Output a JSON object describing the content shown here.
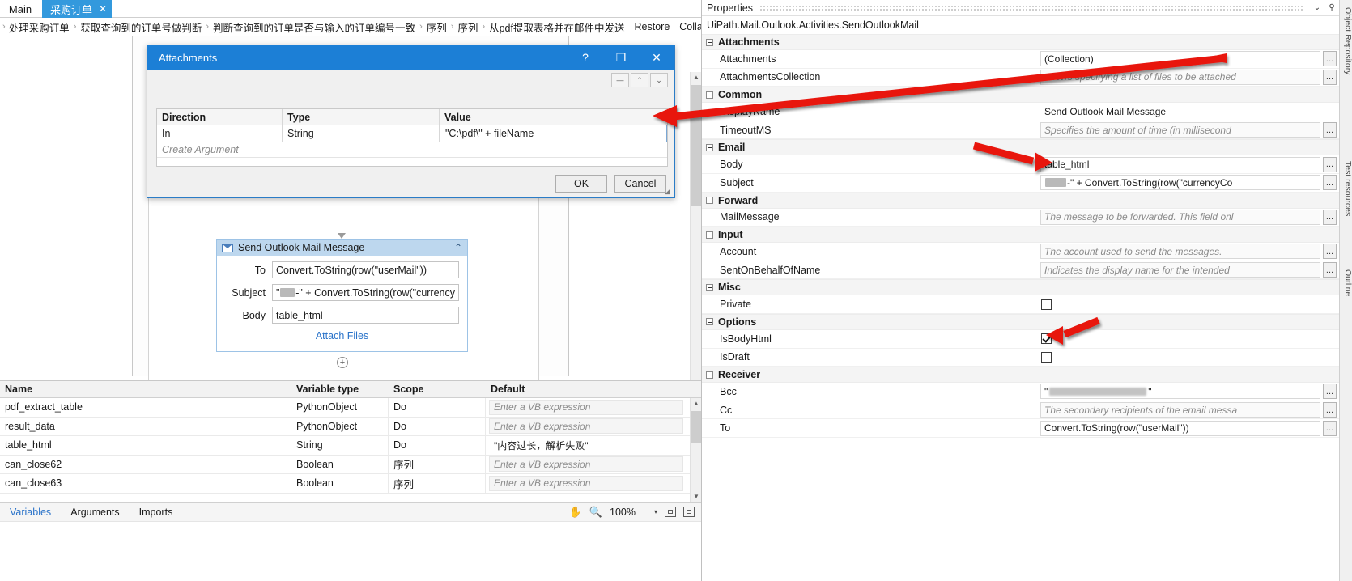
{
  "tabs": {
    "main_label": "Main",
    "active_label": "采购订单",
    "close_glyph": "✕"
  },
  "breadcrumb": {
    "lead": "›",
    "separator": "›",
    "items": [
      "处理采购订单",
      "获取查询到的订单号做判断",
      "判断查询到的订单是否与输入的订单编号一致",
      "序列",
      "序列",
      "从pdf提取表格并在邮件中发送"
    ],
    "restore_label": "Restore",
    "collapse_all_label": "Collapse All"
  },
  "dialog": {
    "title": "Attachments",
    "help_glyph": "?",
    "maximize_glyph": "❐",
    "close_glyph": "✕",
    "toolbar": {
      "remove_glyph": "—",
      "up_glyph": "⌃",
      "down_glyph": "⌄"
    },
    "grid": {
      "headers": [
        "Direction",
        "Type",
        "Value"
      ],
      "rows": [
        {
          "direction": "In",
          "type": "String",
          "value": "\"C:\\pdf\\\" + fileName"
        }
      ],
      "create_argument_placeholder": "Create Argument"
    },
    "ok_label": "OK",
    "cancel_label": "Cancel"
  },
  "activity": {
    "icon": "mail-icon",
    "title": "Send Outlook Mail Message",
    "collapse_glyph": "⌃",
    "fields": [
      {
        "label": "To",
        "value": "Convert.ToString(row(\"userMail\"))",
        "redacted": false
      },
      {
        "label": "Subject",
        "value_prefix": "\"",
        "value_suffix": "-\" + Convert.ToString(row(\"currency",
        "redacted": true
      },
      {
        "label": "Body",
        "value": "table_html",
        "redacted": false
      }
    ],
    "attach_files_label": "Attach Files",
    "add_node_glyph": "+"
  },
  "variables": {
    "headers": [
      "Name",
      "Variable type",
      "Scope",
      "Default"
    ],
    "placeholder": "Enter a VB expression",
    "rows": [
      {
        "name": "pdf_extract_table",
        "type": "PythonObject",
        "scope": "Do",
        "default": "",
        "default_is_placeholder": true
      },
      {
        "name": "result_data",
        "type": "PythonObject",
        "scope": "Do",
        "default": "",
        "default_is_placeholder": true
      },
      {
        "name": "table_html",
        "type": "String",
        "scope": "Do",
        "default": "\"内容过长，解析失败\"",
        "default_is_placeholder": false
      },
      {
        "name": "can_close62",
        "type": "Boolean",
        "scope": "序列",
        "default": "",
        "default_is_placeholder": true
      },
      {
        "name": "can_close63",
        "type": "Boolean",
        "scope": "序列",
        "default": "",
        "default_is_placeholder": true
      }
    ]
  },
  "bottom_bar": {
    "tabs": [
      "Variables",
      "Arguments",
      "Imports"
    ],
    "active_tab": "Variables",
    "pan_icon": "hand-icon",
    "zoom_icon": "magnifier-icon",
    "zoom_value": "100%",
    "zoom_caret": "▾",
    "fit_icon": "fit-to-screen-icon",
    "overview_icon": "overview-icon"
  },
  "properties": {
    "panel_title": "Properties",
    "collapse_glyph": "⌄",
    "pin_glyph": "📌",
    "subtitle": "UiPath.Mail.Outlook.Activities.SendOutlookMail",
    "ellipsis_label": "...",
    "groups": [
      {
        "name": "Attachments",
        "rows": [
          {
            "label": "Attachments",
            "value": "(Collection)",
            "placeholder": false,
            "ellipsis": true,
            "control": "text"
          },
          {
            "label": "AttachmentsCollection",
            "value": "Allows specifying a list of files to be attached",
            "placeholder": true,
            "ellipsis": true,
            "control": "text"
          }
        ]
      },
      {
        "name": "Common",
        "rows": [
          {
            "label": "DisplayName",
            "value": "Send Outlook Mail Message",
            "placeholder": false,
            "ellipsis": false,
            "control": "plain"
          },
          {
            "label": "TimeoutMS",
            "value": "Specifies the amount of time (in millisecond",
            "placeholder": true,
            "ellipsis": true,
            "control": "text"
          }
        ]
      },
      {
        "name": "Email",
        "rows": [
          {
            "label": "Body",
            "value": "table_html",
            "placeholder": false,
            "ellipsis": true,
            "control": "text"
          },
          {
            "label": "Subject",
            "value": "-\" + Convert.ToString(row(\"currencyCo",
            "placeholder": false,
            "ellipsis": true,
            "control": "redacted-text"
          }
        ]
      },
      {
        "name": "Forward",
        "rows": [
          {
            "label": "MailMessage",
            "value": "The message to be forwarded. This field onl",
            "placeholder": true,
            "ellipsis": true,
            "control": "text"
          }
        ]
      },
      {
        "name": "Input",
        "rows": [
          {
            "label": "Account",
            "value": "The account used to send the messages.",
            "placeholder": true,
            "ellipsis": true,
            "control": "text"
          },
          {
            "label": "SentOnBehalfOfName",
            "value": "Indicates the display name for the intended",
            "placeholder": true,
            "ellipsis": true,
            "control": "text"
          }
        ]
      },
      {
        "name": "Misc",
        "rows": [
          {
            "label": "Private",
            "value": "",
            "placeholder": false,
            "ellipsis": false,
            "control": "checkbox",
            "checked": false
          }
        ]
      },
      {
        "name": "Options",
        "rows": [
          {
            "label": "IsBodyHtml",
            "value": "",
            "placeholder": false,
            "ellipsis": false,
            "control": "checkbox",
            "checked": true
          },
          {
            "label": "IsDraft",
            "value": "",
            "placeholder": false,
            "ellipsis": false,
            "control": "checkbox",
            "checked": false
          }
        ]
      },
      {
        "name": "Receiver",
        "rows": [
          {
            "label": "Bcc",
            "value": "\"",
            "placeholder": false,
            "ellipsis": true,
            "control": "redacted-bcc"
          },
          {
            "label": "Cc",
            "value": "The secondary recipients of the email messa",
            "placeholder": true,
            "ellipsis": true,
            "control": "text"
          },
          {
            "label": "To",
            "value": "Convert.ToString(row(\"userMail\"))",
            "placeholder": false,
            "ellipsis": true,
            "control": "text"
          }
        ]
      }
    ]
  },
  "vertical_rail": {
    "tabs": [
      "Object Repository",
      "Test resources",
      "Outline"
    ]
  },
  "colors": {
    "accent": "#1c7fd6",
    "tab_active": "#3399dd",
    "activity_header": "#bdd7ee",
    "link": "#2a73c9",
    "annotation_red": "#e8140d"
  }
}
